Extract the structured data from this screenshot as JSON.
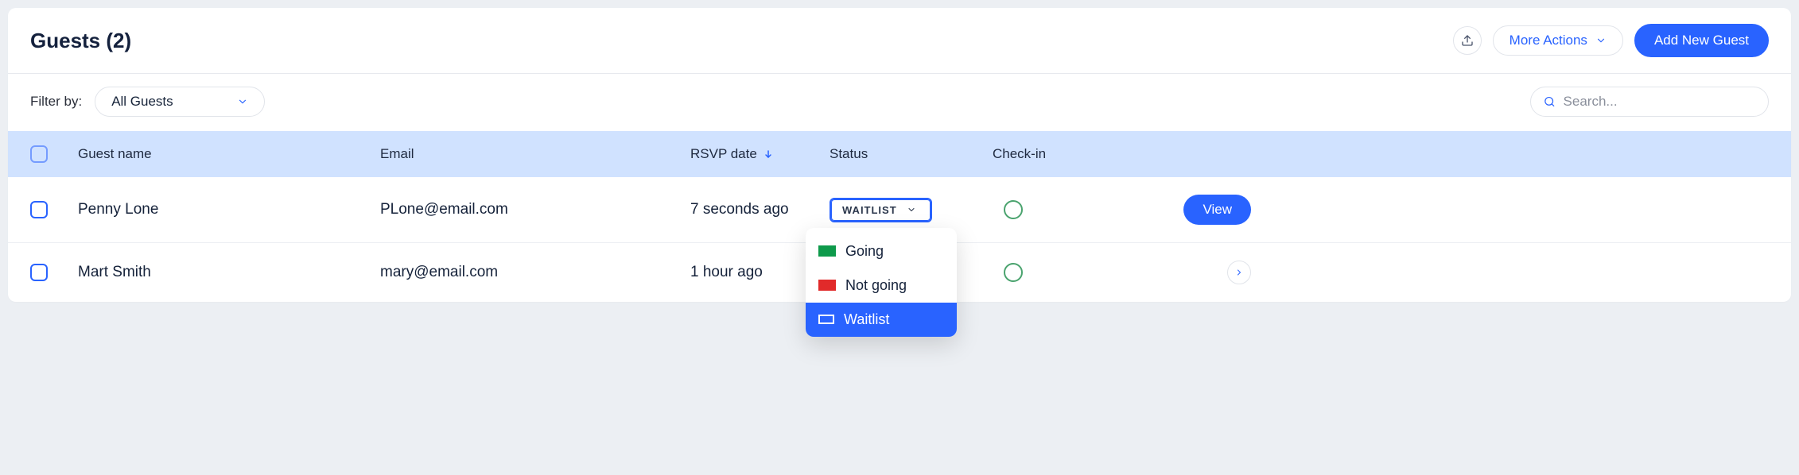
{
  "header": {
    "title": "Guests (2)",
    "more_actions": "More Actions",
    "add_guest": "Add New Guest"
  },
  "filter": {
    "label": "Filter by:",
    "selected": "All Guests"
  },
  "search": {
    "placeholder": "Search..."
  },
  "columns": {
    "name": "Guest name",
    "email": "Email",
    "rsvp": "RSVP date",
    "status": "Status",
    "checkin": "Check-in"
  },
  "rows": [
    {
      "name": "Penny Lone",
      "email": "PLone@email.com",
      "rsvp": "7 seconds ago",
      "status": "WAITLIST",
      "action": "View"
    },
    {
      "name": "Mart Smith",
      "email": "mary@email.com",
      "rsvp": "1 hour ago"
    }
  ],
  "status_options": {
    "going": "Going",
    "not_going": "Not going",
    "waitlist": "Waitlist"
  }
}
